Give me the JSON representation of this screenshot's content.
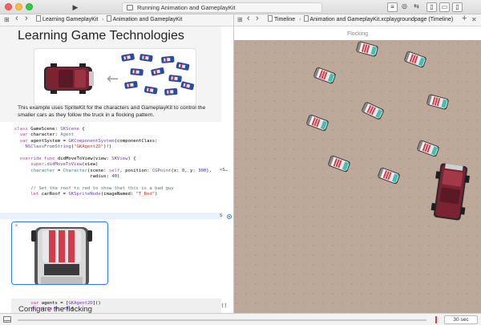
{
  "window": {
    "status_text": "Running Animation and GameplayKit",
    "play_glyph": "▶"
  },
  "toolbar": {
    "icons": [
      "navigator-toggle-icon",
      "editor-icon",
      "assistant-icon",
      "version-icon",
      "left-panel-icon",
      "bottom-panel-icon",
      "right-panel-icon"
    ]
  },
  "left_jumpbar": {
    "grid_glyph": "⊞",
    "back_glyph": "‹",
    "forward_glyph": "›",
    "title": "Learning GameplayKit",
    "separator": "›",
    "page": "Animation and GameplayKit"
  },
  "right_jumpbar": {
    "grid_glyph": "⊞",
    "back_glyph": "‹",
    "forward_glyph": "›",
    "timeline": "Timeline",
    "separator": "›",
    "page": "Animation and GameplayKit.xcplaygroundpage (Timeline)",
    "add_glyph": "+",
    "close_glyph": "✕"
  },
  "doc": {
    "title": "Learning Game Technologies",
    "intro": "This example uses SpriteKit for the characters and GameplayKit to control the smaller cars as they follow the truck in a flocking pattern.",
    "section_title": "Configure the flocking",
    "arrow_glyph": "←"
  },
  "code": {
    "lines": [
      "class GameScene: SKScene {",
      "  var character: Agent",
      "  var agentSystem = GKComponentSystem(componentClass:",
      "    NSClassFromString(\"GKAgent2D\")!)",
      "",
      "  override func didMoveToView(view: SKView) {",
      "      super.didMoveToView(view)",
      "      character = Character(scene: self, position: CGPoint(x: 0, y: 300),",
      "                            radius: 40)",
      "",
      "      // Set the roof to red to show that this is a bad guy",
      "      let carRoof = SKSpriteNode(imageNamed: \"T_Red\")"
    ],
    "line7_result": "<S…",
    "line11_result": "S",
    "lines2": [
      "      var agents = [GKAgent2D]()",
      "      for i in 0..<9 {"
    ],
    "lines2_result": "[]",
    "preview_close": "✕"
  },
  "timeline": {
    "scene_title": "Flocking"
  },
  "bottombar": {
    "seconds": "30 sec"
  }
}
